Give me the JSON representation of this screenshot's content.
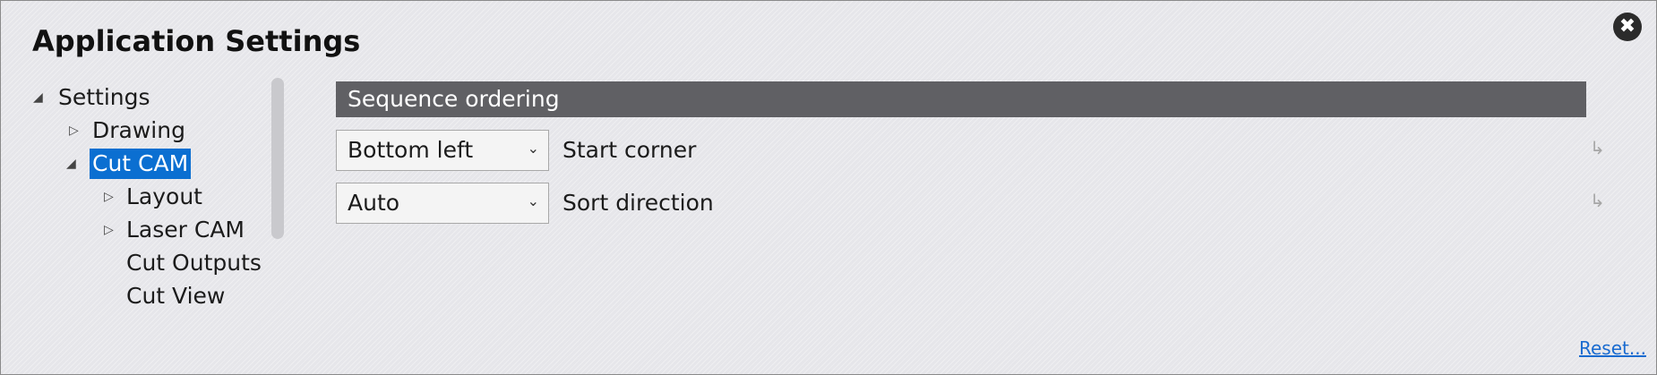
{
  "window": {
    "title": "Application Settings"
  },
  "close_icon": "✖",
  "tree": {
    "nodes": [
      {
        "label": "Settings",
        "arrow": "◢"
      },
      {
        "label": "Drawing",
        "arrow": "▷"
      },
      {
        "label": "Cut CAM",
        "arrow": "◢"
      },
      {
        "label": "Layout",
        "arrow": "▷"
      },
      {
        "label": "Laser CAM",
        "arrow": "▷"
      },
      {
        "label": "Cut Outputs",
        "arrow": ""
      },
      {
        "label": "Cut View",
        "arrow": ""
      }
    ],
    "selected": "Cut CAM"
  },
  "section": {
    "title": "Sequence ordering"
  },
  "settings": [
    {
      "value": "Bottom left",
      "label": "Start corner",
      "chevron": "⌄",
      "reset_icon": "↳"
    },
    {
      "value": "Auto",
      "label": "Sort direction",
      "chevron": "⌄",
      "reset_icon": "↳"
    }
  ],
  "footer": {
    "reset_label": "Reset..."
  },
  "colors": {
    "selection": "#0b6fd1",
    "header_bg": "#606064",
    "link": "#1a6bd0"
  }
}
